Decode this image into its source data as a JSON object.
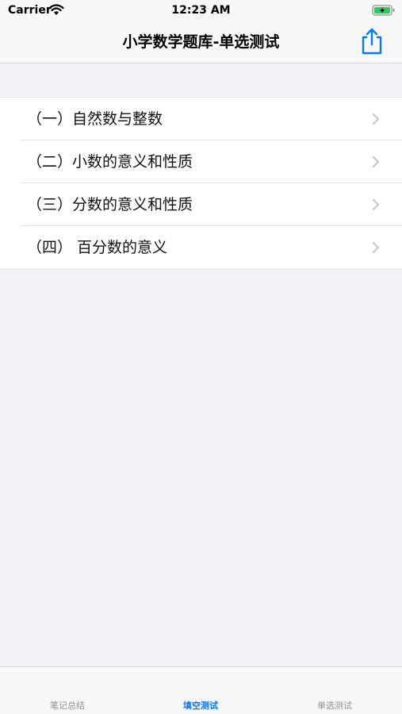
{
  "status_bar": {
    "carrier": "Carrier",
    "time": "12:23 AM",
    "wifi_icon": "wifi-icon",
    "battery_icon": "battery-charging-icon"
  },
  "nav_bar": {
    "title": "小学数学题库-单选测试",
    "share_icon": "share-icon",
    "accent_color": "#007aff"
  },
  "list": {
    "items": [
      {
        "label": "（一）自然数与整数"
      },
      {
        "label": "（二）小数的意义和性质"
      },
      {
        "label": "（三）分数的意义和性质"
      },
      {
        "label": "（四） 百分数的意义"
      }
    ],
    "chevron_icon": "chevron-right-icon"
  },
  "tab_bar": {
    "tabs": [
      {
        "label": "笔记总结",
        "active": false
      },
      {
        "label": "填空测试",
        "active": true
      },
      {
        "label": "单选测试",
        "active": false
      }
    ]
  }
}
